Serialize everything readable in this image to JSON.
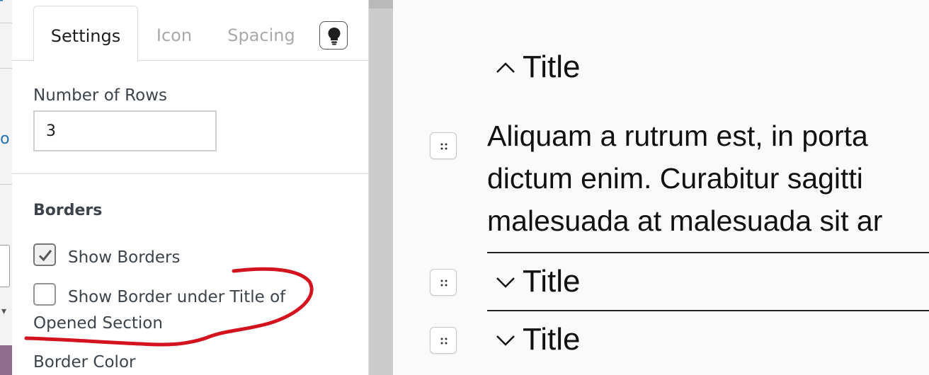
{
  "settings_panel": {
    "tabs": [
      {
        "label": "Settings"
      },
      {
        "label": "Icon"
      },
      {
        "label": "Spacing"
      }
    ],
    "tips_icon": "lightbulb-icon",
    "number_of_rows": {
      "label": "Number of Rows",
      "value": "3"
    },
    "borders": {
      "heading": "Borders",
      "show_borders": {
        "label": "Show Borders",
        "checked": true
      },
      "show_border_under_title": {
        "label_line1": "Show Border under Title of",
        "label_line2": "Opened Section",
        "checked": false
      }
    },
    "border_color": {
      "label": "Border Color"
    }
  },
  "accordion": {
    "items": [
      {
        "title": "Title",
        "expanded": true,
        "icon": "chevron-up-icon",
        "body_lines": [
          "Aliquam a rutrum est, in porta",
          "dictum enim. Curabitur sagitti",
          "malesuada at malesuada sit ar"
        ]
      },
      {
        "title": "Title",
        "expanded": false,
        "icon": "chevron-down-icon"
      },
      {
        "title": "Title",
        "expanded": false,
        "icon": "chevron-down-icon"
      }
    ],
    "drag_handle_icon": "drag-handle-icon"
  },
  "colors": {
    "annotation": "#d3141f",
    "accent_link": "#2271b1"
  }
}
